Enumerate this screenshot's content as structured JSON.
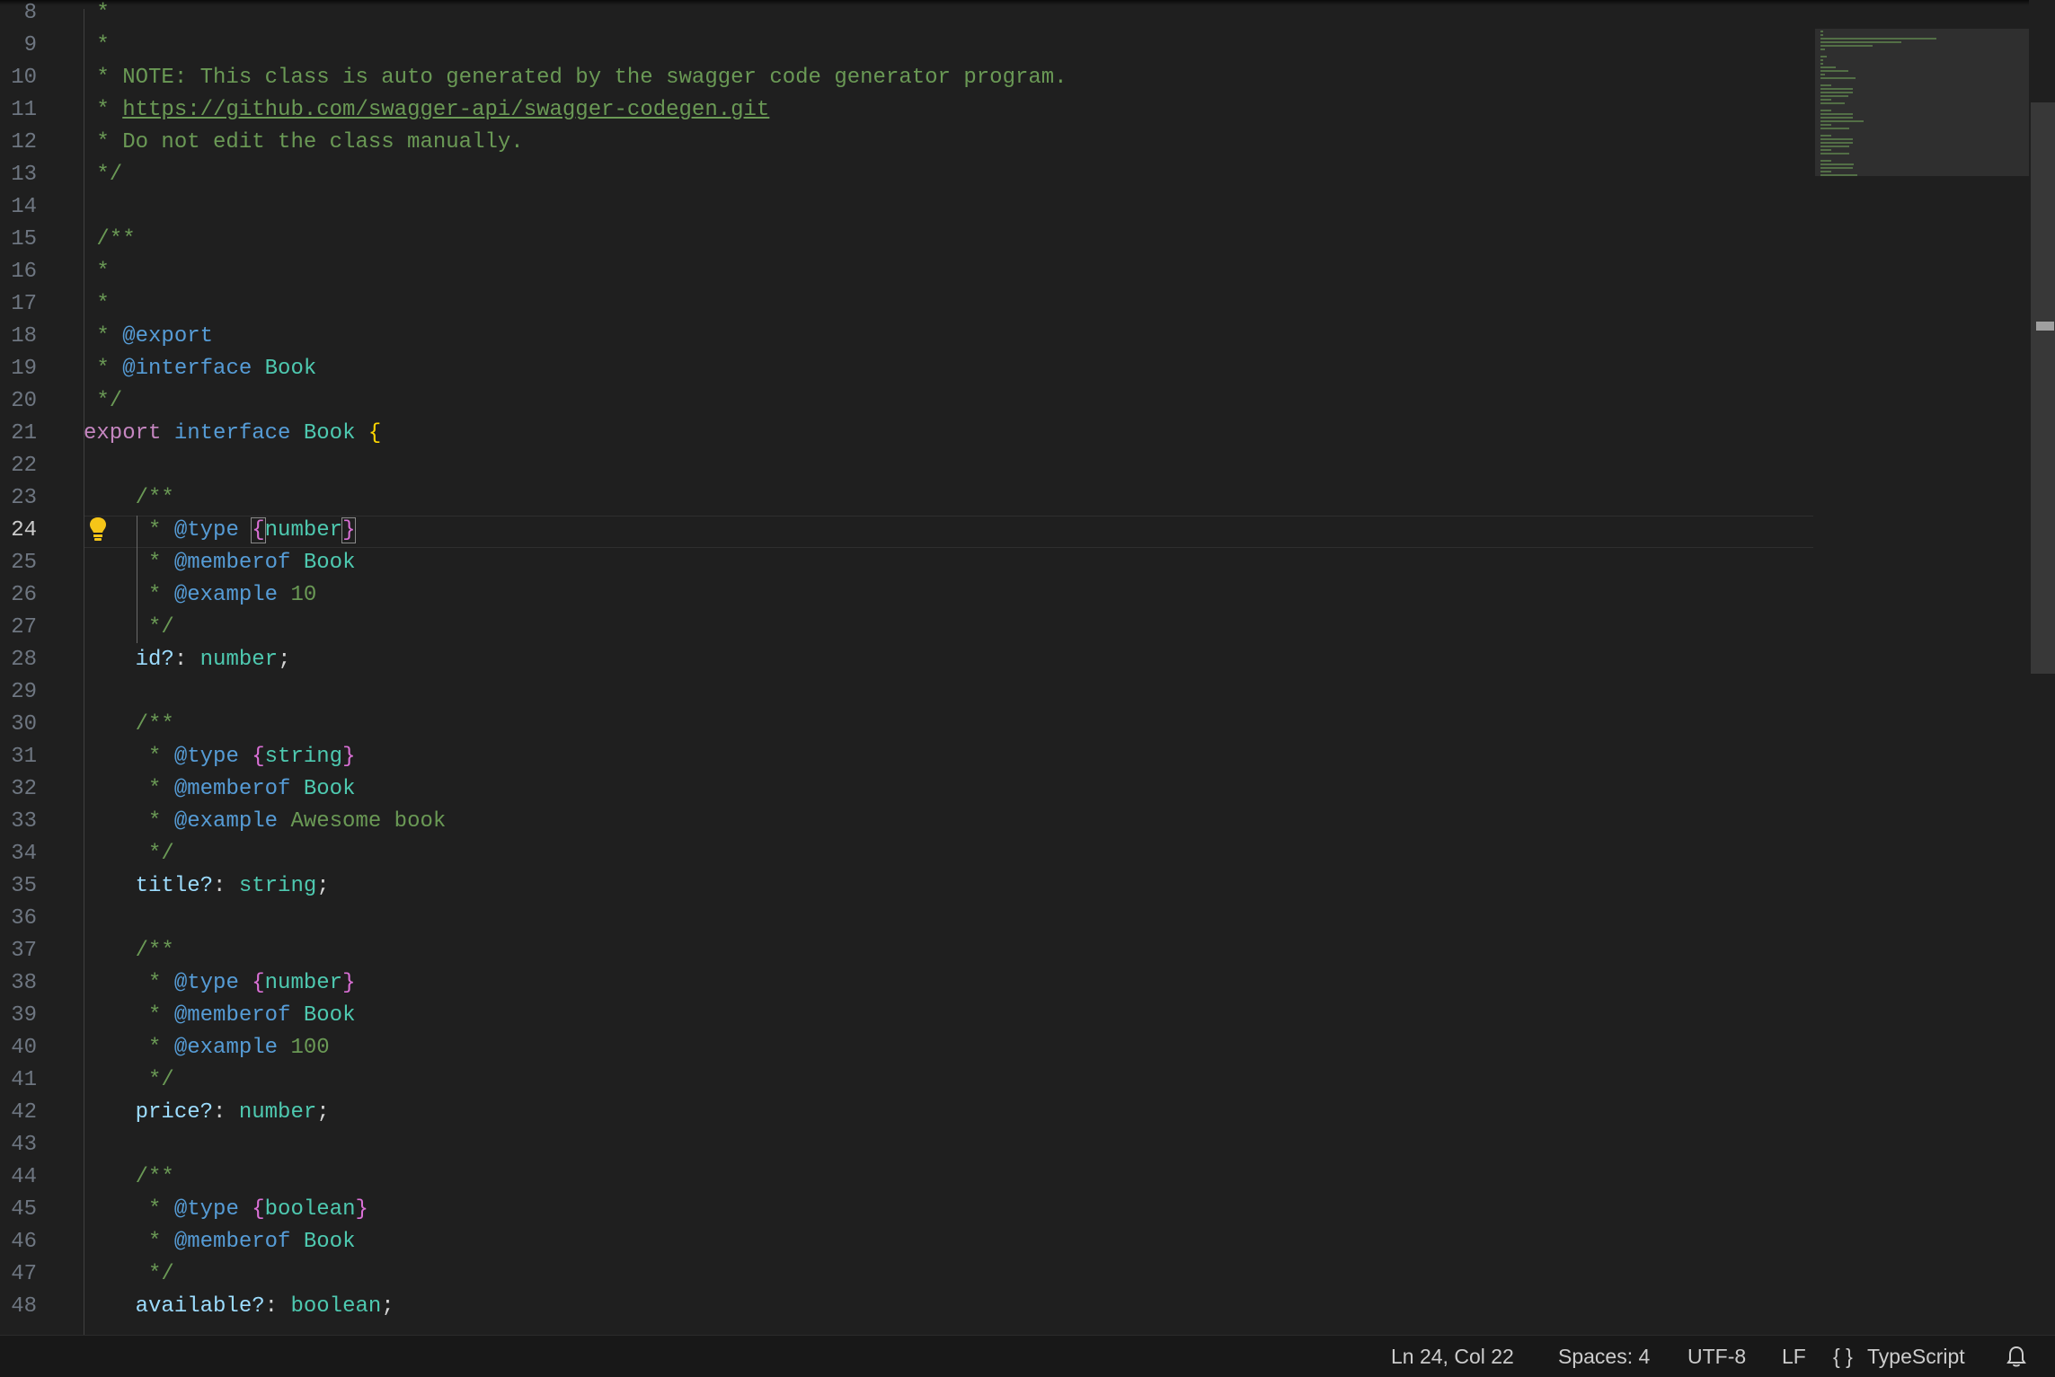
{
  "editor": {
    "active_line": "24",
    "lines": [
      {
        "n": "8",
        "parts": [
          {
            "t": " *",
            "k": "c"
          }
        ]
      },
      {
        "n": "9",
        "parts": [
          {
            "t": " *",
            "k": "c"
          }
        ]
      },
      {
        "n": "10",
        "parts": [
          {
            "t": " * NOTE: This class is auto generated by the swagger code generator program.",
            "k": "c"
          }
        ]
      },
      {
        "n": "11",
        "parts": [
          {
            "t": " * ",
            "k": "c"
          },
          {
            "t": "https://github.com/swagger-api/swagger-codegen.git",
            "k": "lnk"
          }
        ]
      },
      {
        "n": "12",
        "parts": [
          {
            "t": " * Do not edit the class manually.",
            "k": "c"
          }
        ]
      },
      {
        "n": "13",
        "parts": [
          {
            "t": " */",
            "k": "c"
          }
        ]
      },
      {
        "n": "14",
        "parts": []
      },
      {
        "n": "15",
        "parts": [
          {
            "t": " /**",
            "k": "c"
          }
        ]
      },
      {
        "n": "16",
        "parts": [
          {
            "t": " *",
            "k": "c"
          }
        ]
      },
      {
        "n": "17",
        "parts": [
          {
            "t": " *",
            "k": "c"
          }
        ]
      },
      {
        "n": "18",
        "parts": [
          {
            "t": " * ",
            "k": "c"
          },
          {
            "t": "@export",
            "k": "tag"
          }
        ]
      },
      {
        "n": "19",
        "parts": [
          {
            "t": " * ",
            "k": "c"
          },
          {
            "t": "@interface",
            "k": "tag"
          },
          {
            "t": " ",
            "k": "c"
          },
          {
            "t": "Book",
            "k": "tp"
          }
        ]
      },
      {
        "n": "20",
        "parts": [
          {
            "t": " */",
            "k": "c"
          }
        ]
      },
      {
        "n": "21",
        "parts": [
          {
            "t": "export",
            "k": "kw"
          },
          {
            "t": " ",
            "k": "c"
          },
          {
            "t": "interface",
            "k": "kwb"
          },
          {
            "t": " ",
            "k": "c"
          },
          {
            "t": "Book",
            "k": "tp"
          },
          {
            "t": " ",
            "k": "c"
          },
          {
            "t": "{",
            "k": "brace"
          }
        ]
      },
      {
        "n": "22",
        "parts": []
      },
      {
        "n": "23",
        "parts": [
          {
            "t": "    /**",
            "k": "c"
          }
        ]
      },
      {
        "n": "24",
        "parts": [
          {
            "t": "     * ",
            "k": "c"
          },
          {
            "t": "@type",
            "k": "tag"
          },
          {
            "t": " ",
            "k": "c"
          },
          {
            "t": "{",
            "k": "cbrace",
            "box": true
          },
          {
            "t": "number",
            "k": "tp"
          },
          {
            "t": "}",
            "k": "cbrace",
            "box": true
          }
        ]
      },
      {
        "n": "25",
        "parts": [
          {
            "t": "     * ",
            "k": "c"
          },
          {
            "t": "@memberof",
            "k": "tag"
          },
          {
            "t": " ",
            "k": "c"
          },
          {
            "t": "Book",
            "k": "tp"
          }
        ]
      },
      {
        "n": "26",
        "parts": [
          {
            "t": "     * ",
            "k": "c"
          },
          {
            "t": "@example",
            "k": "tag"
          },
          {
            "t": " 10",
            "k": "c"
          }
        ]
      },
      {
        "n": "27",
        "parts": [
          {
            "t": "     */",
            "k": "c"
          }
        ]
      },
      {
        "n": "28",
        "parts": [
          {
            "t": "    ",
            "k": "c"
          },
          {
            "t": "id?",
            "k": "prop"
          },
          {
            "t": ": ",
            "k": "sep"
          },
          {
            "t": "number",
            "k": "tp"
          },
          {
            "t": ";",
            "k": "sep"
          }
        ]
      },
      {
        "n": "29",
        "parts": []
      },
      {
        "n": "30",
        "parts": [
          {
            "t": "    /**",
            "k": "c"
          }
        ]
      },
      {
        "n": "31",
        "parts": [
          {
            "t": "     * ",
            "k": "c"
          },
          {
            "t": "@type",
            "k": "tag"
          },
          {
            "t": " ",
            "k": "c"
          },
          {
            "t": "{",
            "k": "cbrace"
          },
          {
            "t": "string",
            "k": "tp"
          },
          {
            "t": "}",
            "k": "cbrace"
          }
        ]
      },
      {
        "n": "32",
        "parts": [
          {
            "t": "     * ",
            "k": "c"
          },
          {
            "t": "@memberof",
            "k": "tag"
          },
          {
            "t": " ",
            "k": "c"
          },
          {
            "t": "Book",
            "k": "tp"
          }
        ]
      },
      {
        "n": "33",
        "parts": [
          {
            "t": "     * ",
            "k": "c"
          },
          {
            "t": "@example",
            "k": "tag"
          },
          {
            "t": " Awesome book",
            "k": "c"
          }
        ]
      },
      {
        "n": "34",
        "parts": [
          {
            "t": "     */",
            "k": "c"
          }
        ]
      },
      {
        "n": "35",
        "parts": [
          {
            "t": "    ",
            "k": "c"
          },
          {
            "t": "title?",
            "k": "prop"
          },
          {
            "t": ": ",
            "k": "sep"
          },
          {
            "t": "string",
            "k": "tp"
          },
          {
            "t": ";",
            "k": "sep"
          }
        ]
      },
      {
        "n": "36",
        "parts": []
      },
      {
        "n": "37",
        "parts": [
          {
            "t": "    /**",
            "k": "c"
          }
        ]
      },
      {
        "n": "38",
        "parts": [
          {
            "t": "     * ",
            "k": "c"
          },
          {
            "t": "@type",
            "k": "tag"
          },
          {
            "t": " ",
            "k": "c"
          },
          {
            "t": "{",
            "k": "cbrace"
          },
          {
            "t": "number",
            "k": "tp"
          },
          {
            "t": "}",
            "k": "cbrace"
          }
        ]
      },
      {
        "n": "39",
        "parts": [
          {
            "t": "     * ",
            "k": "c"
          },
          {
            "t": "@memberof",
            "k": "tag"
          },
          {
            "t": " ",
            "k": "c"
          },
          {
            "t": "Book",
            "k": "tp"
          }
        ]
      },
      {
        "n": "40",
        "parts": [
          {
            "t": "     * ",
            "k": "c"
          },
          {
            "t": "@example",
            "k": "tag"
          },
          {
            "t": " 100",
            "k": "c"
          }
        ]
      },
      {
        "n": "41",
        "parts": [
          {
            "t": "     */",
            "k": "c"
          }
        ]
      },
      {
        "n": "42",
        "parts": [
          {
            "t": "    ",
            "k": "c"
          },
          {
            "t": "price?",
            "k": "prop"
          },
          {
            "t": ": ",
            "k": "sep"
          },
          {
            "t": "number",
            "k": "tp"
          },
          {
            "t": ";",
            "k": "sep"
          }
        ]
      },
      {
        "n": "43",
        "parts": []
      },
      {
        "n": "44",
        "parts": [
          {
            "t": "    /**",
            "k": "c"
          }
        ]
      },
      {
        "n": "45",
        "parts": [
          {
            "t": "     * ",
            "k": "c"
          },
          {
            "t": "@type",
            "k": "tag"
          },
          {
            "t": " ",
            "k": "c"
          },
          {
            "t": "{",
            "k": "cbrace"
          },
          {
            "t": "boolean",
            "k": "tp"
          },
          {
            "t": "}",
            "k": "cbrace"
          }
        ]
      },
      {
        "n": "46",
        "parts": [
          {
            "t": "     * ",
            "k": "c"
          },
          {
            "t": "@memberof",
            "k": "tag"
          },
          {
            "t": " ",
            "k": "c"
          },
          {
            "t": "Book",
            "k": "tp"
          }
        ]
      },
      {
        "n": "47",
        "parts": [
          {
            "t": "     */",
            "k": "c"
          }
        ]
      },
      {
        "n": "48",
        "parts": [
          {
            "t": "    ",
            "k": "c"
          },
          {
            "t": "available?",
            "k": "prop"
          },
          {
            "t": ": ",
            "k": "sep"
          },
          {
            "t": "boolean",
            "k": "tp"
          },
          {
            "t": ";",
            "k": "sep"
          }
        ]
      }
    ],
    "lightbulb_icon": "lightbulb-icon"
  },
  "colors": {
    "background": "#1f1f1f",
    "comment": "#6a9955",
    "jsdoc_tag": "#569cd6",
    "type": "#4ec9b0",
    "keyword": "#c586c0",
    "property": "#9cdcfe",
    "brace": "#ffd700",
    "bulb": "#f5c518"
  },
  "statusbar": {
    "position": "Ln 24, Col 22",
    "spaces": "Spaces: 4",
    "encoding": "UTF-8",
    "eol": "LF",
    "language_icon": "{ }",
    "language": "TypeScript",
    "bell_icon": "bell-icon"
  }
}
